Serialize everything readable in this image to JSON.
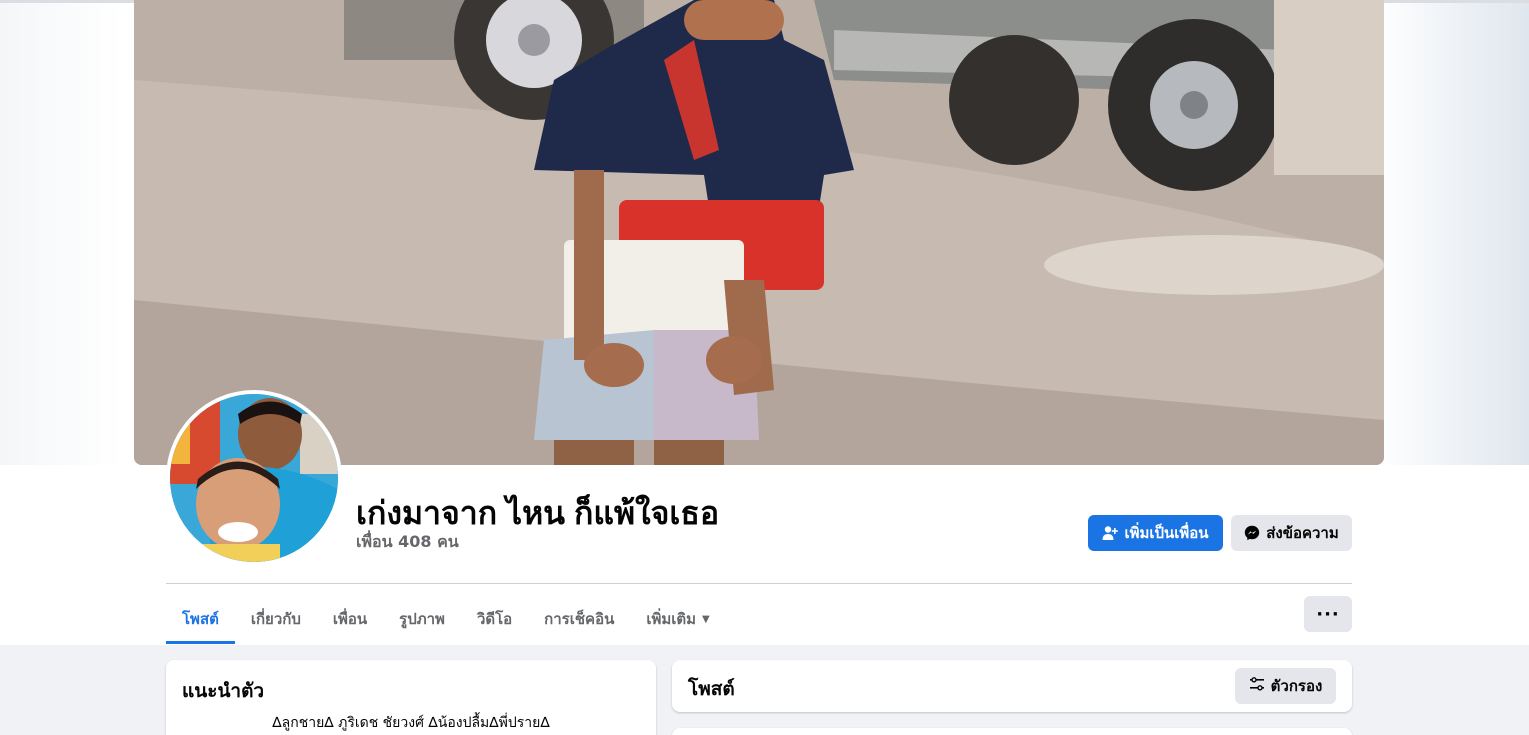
{
  "profile": {
    "name": "เก่งมาจาก ไหน ก็แพ้ใจเธอ",
    "friends_count_text": "เพื่อน 408 คน"
  },
  "actions": {
    "add_friend_label": "เพิ่มเป็นเพื่อน",
    "message_label": "ส่งข้อความ",
    "more_label": "···"
  },
  "tabs": [
    {
      "label": "โพสต์",
      "active": true
    },
    {
      "label": "เกี่ยวกับ",
      "active": false
    },
    {
      "label": "เพื่อน",
      "active": false
    },
    {
      "label": "รูปภาพ",
      "active": false
    },
    {
      "label": "วิดีโอ",
      "active": false
    },
    {
      "label": "การเช็คอิน",
      "active": false
    },
    {
      "label": "เพิ่มเติม",
      "active": false
    }
  ],
  "intro": {
    "title": "แนะนำตัว",
    "bio": "∆ลูกชาย∆ ภูริเดช ชัยวงศ์ ∆น้องปลื้ม∆พี่ปราย∆"
  },
  "posts": {
    "title": "โพสต์",
    "filter_label": "ตัวกรอง"
  },
  "icons": {
    "add_friend": "add-friend-icon",
    "messenger": "messenger-icon",
    "filter": "filter-icon",
    "caret": "caret-down-icon"
  },
  "colors": {
    "accent": "#1b74e4",
    "secondary_button": "#e4e6eb",
    "muted_text": "#65676b",
    "page_background": "#f0f2f5"
  }
}
